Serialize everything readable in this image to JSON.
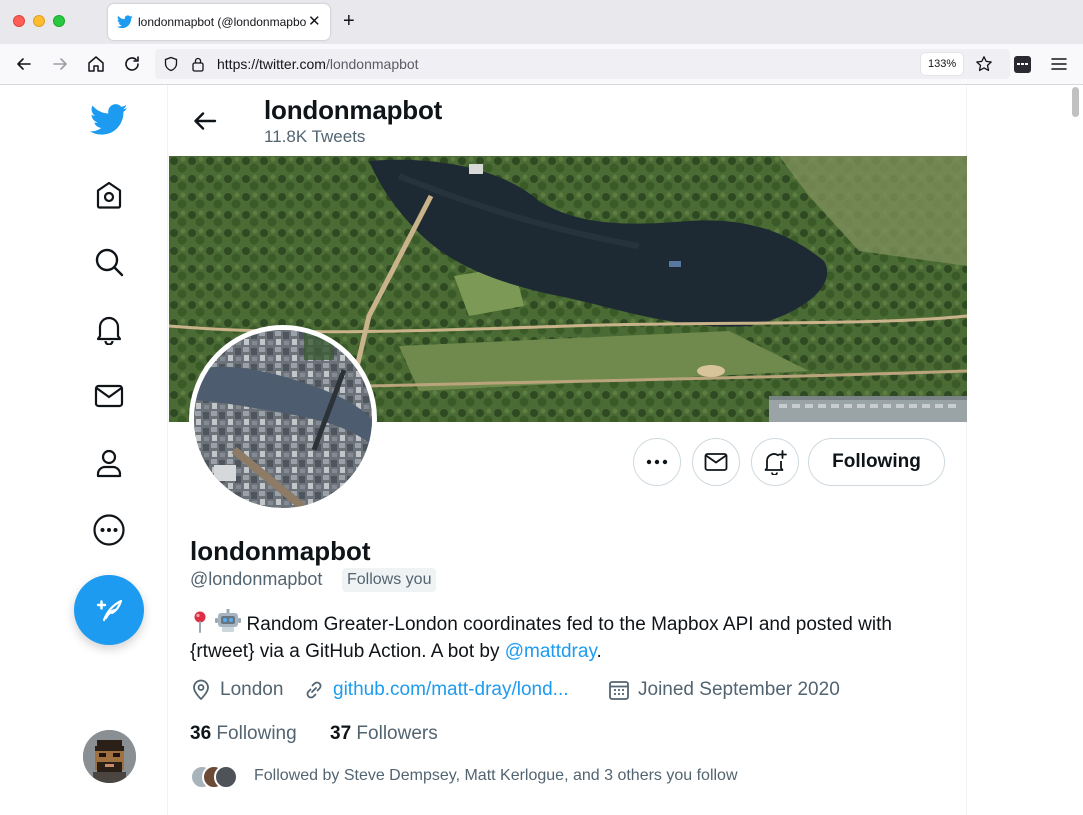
{
  "browser": {
    "tab_title": "londonmapbot (@londonmapbot",
    "url_host": "https://twitter.com",
    "url_path": "/londonmapbot",
    "zoom": "133%"
  },
  "header": {
    "name": "londonmapbot",
    "tweet_count": "11.8K Tweets"
  },
  "actions": {
    "following_label": "Following"
  },
  "profile": {
    "name": "londonmapbot",
    "handle": "@londonmapbot",
    "follows_you": "Follows you",
    "bio_text": " Random Greater-London coordinates fed to the Mapbox API and posted with {rtweet} via a GitHub Action. A bot by ",
    "bio_mention": "@mattdray",
    "bio_end": ".",
    "location": "London",
    "website": "github.com/matt-dray/lond...",
    "joined": "Joined September 2020",
    "following_count": "36",
    "following_label": "Following",
    "followers_count": "37",
    "followers_label": "Followers",
    "followed_by": "Followed by Steve Dempsey, Matt Kerlogue, and 3 others you follow"
  },
  "colors": {
    "accent": "#1d9bf0",
    "text_primary": "#0f1419",
    "text_secondary": "#536471"
  },
  "icons": [
    "twitter-logo-icon",
    "home-icon",
    "search-icon",
    "notifications-icon",
    "messages-icon",
    "profile-icon",
    "more-icon",
    "compose-tweet-icon",
    "back-arrow-icon",
    "location-icon",
    "link-icon",
    "calendar-icon",
    "mail-icon",
    "notification-add-icon"
  ]
}
